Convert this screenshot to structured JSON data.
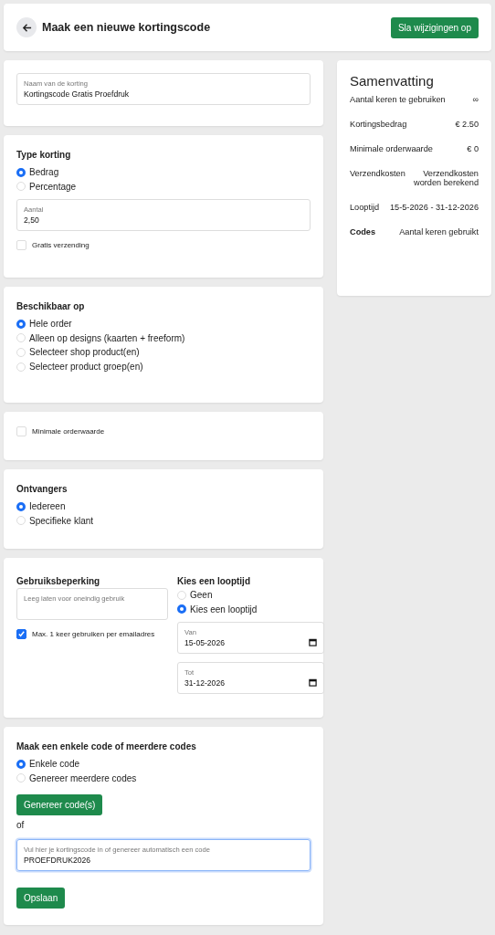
{
  "header": {
    "title": "Maak een nieuwe kortingscode",
    "save_button": "Sla wijzigingen op"
  },
  "name_field": {
    "label": "Naam van de korting",
    "value": "Kortingscode Gratis Proefdruk"
  },
  "discount_type": {
    "title": "Type korting",
    "options": [
      {
        "label": "Bedrag",
        "selected": true
      },
      {
        "label": "Percentage",
        "selected": false
      }
    ],
    "amount_field": {
      "label": "Aantal",
      "value": "2,50"
    },
    "free_shipping": {
      "label": "Gratis verzending",
      "checked": false
    }
  },
  "available_on": {
    "title": "Beschikbaar op",
    "options": [
      {
        "label": "Hele order",
        "selected": true
      },
      {
        "label": "Alleen op designs (kaarten + freeform)",
        "selected": false
      },
      {
        "label": "Selecteer shop product(en)",
        "selected": false
      },
      {
        "label": "Selecteer product groep(en)",
        "selected": false
      }
    ]
  },
  "minimum_order": {
    "label": "Minimale orderwaarde",
    "checked": false
  },
  "recipients": {
    "title": "Ontvangers",
    "options": [
      {
        "label": "Iedereen",
        "selected": true
      },
      {
        "label": "Specifieke klant",
        "selected": false
      }
    ]
  },
  "usage_limit": {
    "title": "Gebruiksbeperking",
    "placeholder": "Leeg laten voor oneindig gebruik",
    "once_per_email": {
      "label": "Max. 1 keer gebruiken per emailadres",
      "checked": true
    }
  },
  "period": {
    "title": "Kies een looptijd",
    "options": [
      {
        "label": "Geen",
        "selected": false
      },
      {
        "label": "Kies een looptijd",
        "selected": true
      }
    ],
    "from": {
      "label": "Van",
      "value": "15-05-2026"
    },
    "to": {
      "label": "Tot",
      "value": "31-12-2026"
    }
  },
  "codes": {
    "title": "Maak een enkele code of meerdere codes",
    "options": [
      {
        "label": "Enkele code",
        "selected": true
      },
      {
        "label": "Genereer meerdere codes",
        "selected": false
      }
    ],
    "generate_button": "Genereer code(s)",
    "or": "of",
    "code_field": {
      "label": "Vul hier je kortingscode in of genereer automatisch een code",
      "value": "PROEFDRUK2026",
      "focused": true
    },
    "save_button": "Opslaan"
  },
  "summary": {
    "title": "Samenvatting",
    "rows": [
      {
        "kind": "plain",
        "label": "Aantal keren te gebruiken",
        "value": "∞"
      },
      {
        "kind": "plain",
        "label": "Kortingsbedrag",
        "value": "€ 2.50"
      },
      {
        "kind": "plain",
        "label": "Minimale orderwaarde",
        "value": "€ 0"
      },
      {
        "kind": "plain",
        "label": "Verzendkosten",
        "value": "Verzendkosten worden berekend"
      },
      {
        "kind": "plain",
        "label": "Looptijd",
        "value": "15-5-2026 - 31-12-2026"
      },
      {
        "kind": "heading",
        "label": "Codes",
        "value": "Aantal keren gebruikt"
      }
    ]
  }
}
